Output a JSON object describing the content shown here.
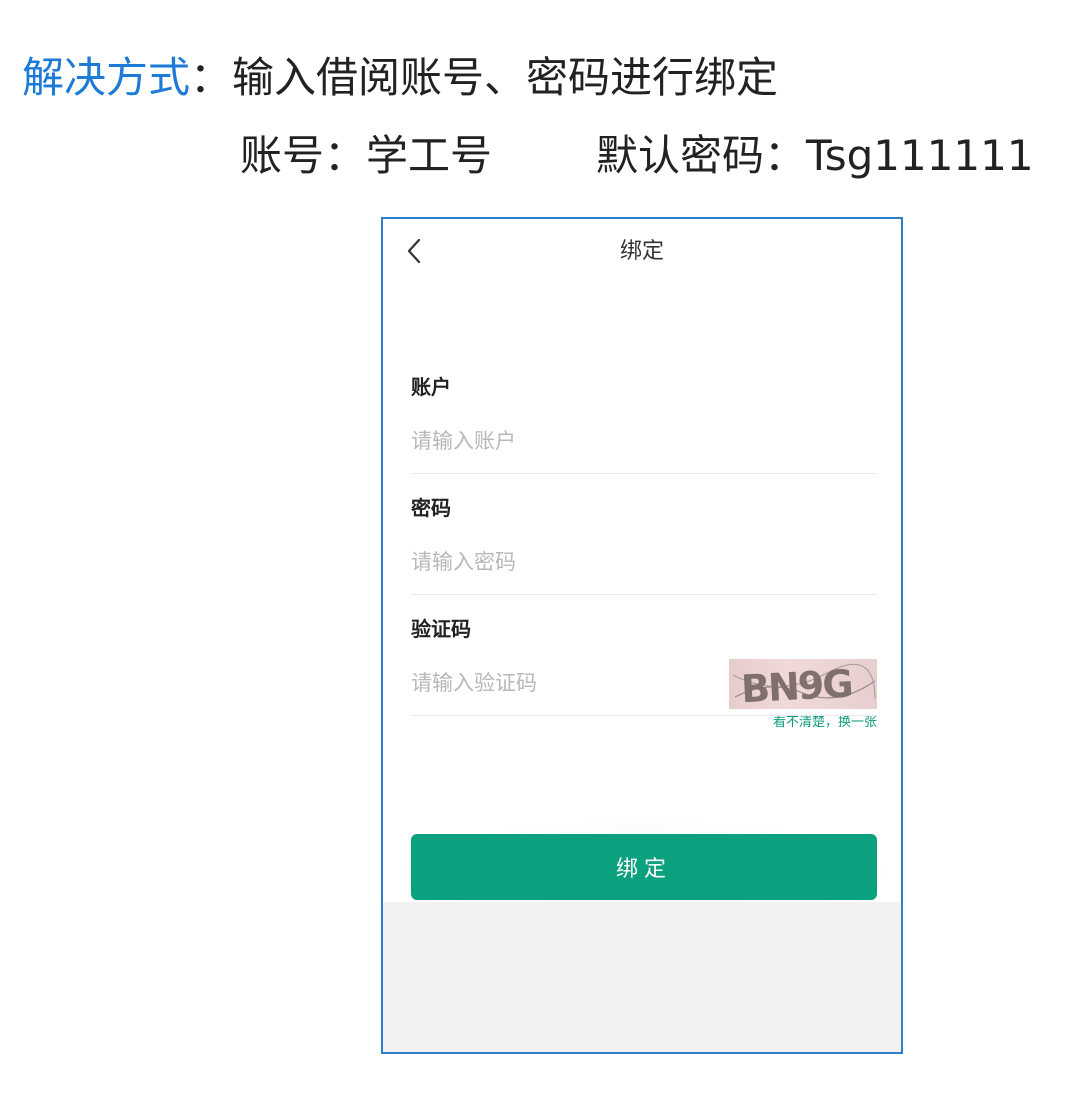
{
  "instruction": {
    "title": "解决方式",
    "colon": "：",
    "text": "输入借阅账号、密码进行绑定",
    "account_note": "账号：学工号",
    "password_note": "默认密码：Tsg111111"
  },
  "app": {
    "nav_title": "绑定",
    "back_icon": "chevron-left-icon",
    "form": {
      "account": {
        "label": "账户",
        "placeholder": "请输入账户",
        "value": ""
      },
      "password": {
        "label": "密码",
        "placeholder": "请输入密码",
        "value": ""
      },
      "captcha": {
        "label": "验证码",
        "placeholder": "请输入验证码",
        "value": "",
        "image_text": "BN9G",
        "refresh_label": "看不清楚，换一张"
      }
    },
    "submit_label": "绑定"
  },
  "colors": {
    "accent_blue": "#1d7ad6",
    "button_green": "#0ba07e",
    "link_green": "#0e9b7c",
    "frame_border": "#2f7fc9"
  }
}
